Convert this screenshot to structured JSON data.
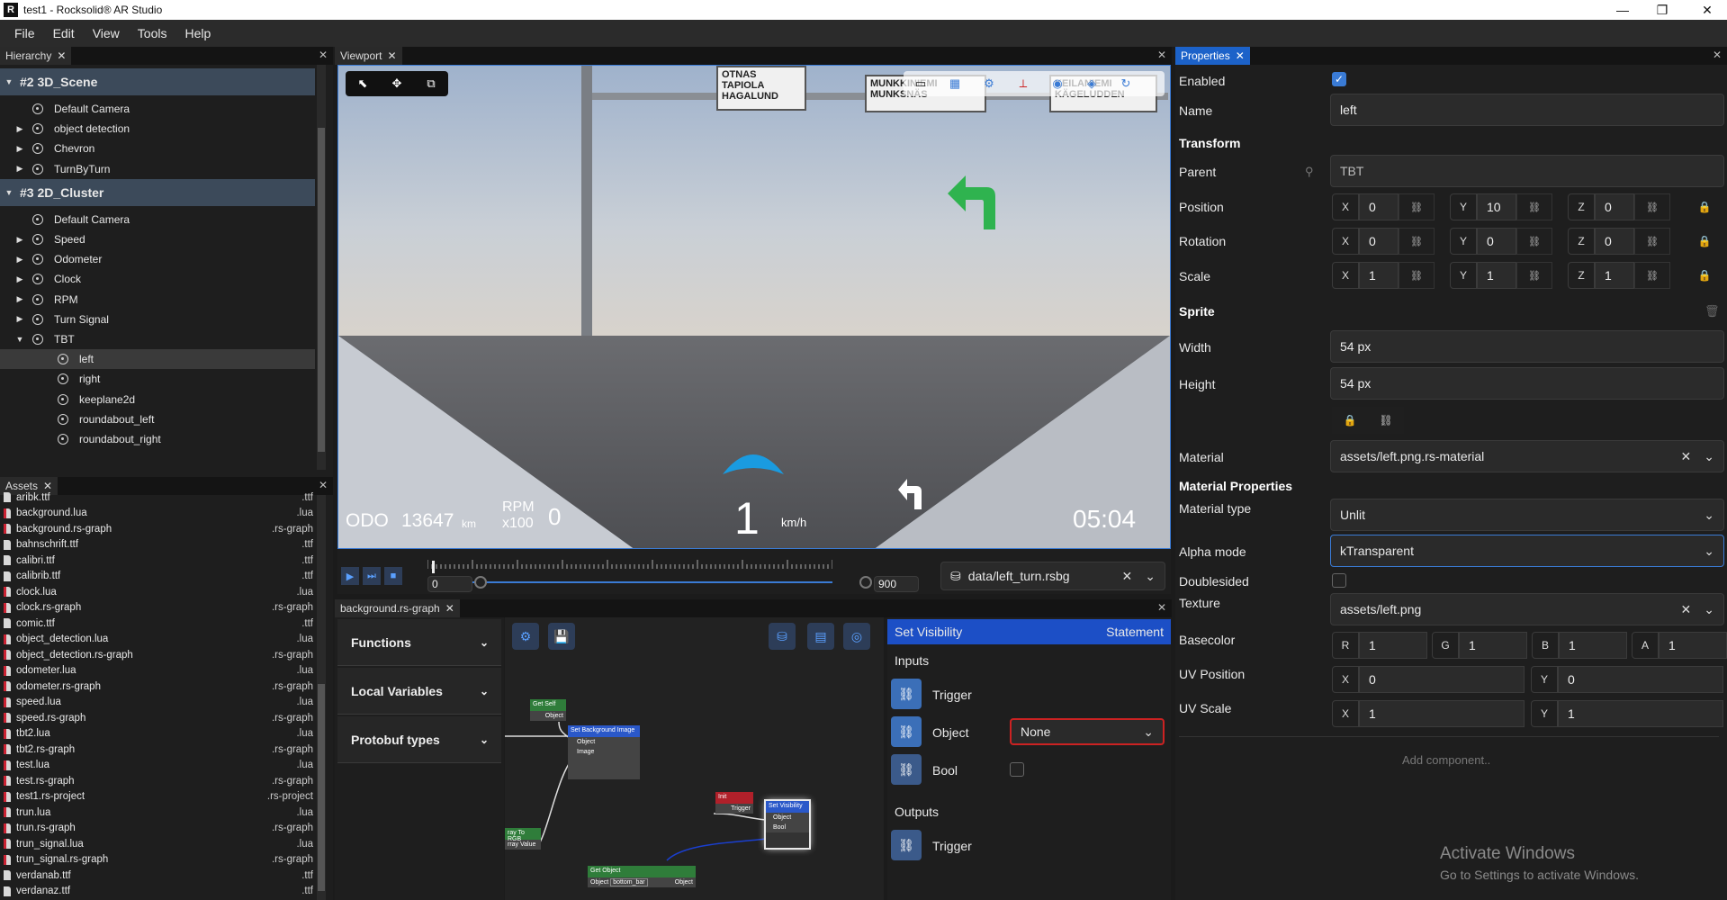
{
  "window": {
    "title": "test1 - Rocksolid® AR Studio",
    "logo": "R"
  },
  "menu": [
    "File",
    "Edit",
    "View",
    "Tools",
    "Help"
  ],
  "hierarchy": {
    "tab": "Hierarchy",
    "rows": [
      {
        "label": "#2 3D_Scene",
        "kind": "group"
      },
      {
        "label": "Default Camera",
        "kind": "item",
        "depth": 1,
        "expandable": false
      },
      {
        "label": "object detection",
        "kind": "item",
        "depth": 1,
        "expandable": true
      },
      {
        "label": "Chevron",
        "kind": "item",
        "depth": 1,
        "expandable": true
      },
      {
        "label": "TurnByTurn",
        "kind": "item",
        "depth": 1,
        "expandable": true
      },
      {
        "label": "#3 2D_Cluster",
        "kind": "group"
      },
      {
        "label": "Default Camera",
        "kind": "item",
        "depth": 1,
        "expandable": false
      },
      {
        "label": "Speed",
        "kind": "item",
        "depth": 1,
        "expandable": true
      },
      {
        "label": "Odometer",
        "kind": "item",
        "depth": 1,
        "expandable": true
      },
      {
        "label": "Clock",
        "kind": "item",
        "depth": 1,
        "expandable": true
      },
      {
        "label": "RPM",
        "kind": "item",
        "depth": 1,
        "expandable": true
      },
      {
        "label": "Turn Signal",
        "kind": "item",
        "depth": 1,
        "expandable": true
      },
      {
        "label": "TBT",
        "kind": "item",
        "depth": 1,
        "expandable": true,
        "expanded": true
      },
      {
        "label": "left",
        "kind": "item",
        "depth": 2,
        "selected": true
      },
      {
        "label": "right",
        "kind": "item",
        "depth": 2
      },
      {
        "label": "keeplane2d",
        "kind": "item",
        "depth": 2
      },
      {
        "label": "roundabout_left",
        "kind": "item",
        "depth": 2
      },
      {
        "label": "roundabout_right",
        "kind": "item",
        "depth": 2
      }
    ]
  },
  "assets": {
    "tab": "Assets",
    "files": [
      {
        "name": "aribk.ttf",
        "ext": ".ttf"
      },
      {
        "name": "background.lua",
        "ext": ".lua"
      },
      {
        "name": "background.rs-graph",
        "ext": ".rs-graph"
      },
      {
        "name": "bahnschrift.ttf",
        "ext": ".ttf"
      },
      {
        "name": "calibri.ttf",
        "ext": ".ttf"
      },
      {
        "name": "calibrib.ttf",
        "ext": ".ttf"
      },
      {
        "name": "clock.lua",
        "ext": ".lua"
      },
      {
        "name": "clock.rs-graph",
        "ext": ".rs-graph"
      },
      {
        "name": "comic.ttf",
        "ext": ".ttf"
      },
      {
        "name": "object_detection.lua",
        "ext": ".lua"
      },
      {
        "name": "object_detection.rs-graph",
        "ext": ".rs-graph"
      },
      {
        "name": "odometer.lua",
        "ext": ".lua"
      },
      {
        "name": "odometer.rs-graph",
        "ext": ".rs-graph"
      },
      {
        "name": "speed.lua",
        "ext": ".lua"
      },
      {
        "name": "speed.rs-graph",
        "ext": ".rs-graph"
      },
      {
        "name": "tbt2.lua",
        "ext": ".lua"
      },
      {
        "name": "tbt2.rs-graph",
        "ext": ".rs-graph"
      },
      {
        "name": "test.lua",
        "ext": ".lua"
      },
      {
        "name": "test.rs-graph",
        "ext": ".rs-graph"
      },
      {
        "name": "test1.rs-project",
        "ext": ".rs-project"
      },
      {
        "name": "trun.lua",
        "ext": ".lua"
      },
      {
        "name": "trun.rs-graph",
        "ext": ".rs-graph"
      },
      {
        "name": "trun_signal.lua",
        "ext": ".lua"
      },
      {
        "name": "trun_signal.rs-graph",
        "ext": ".rs-graph"
      },
      {
        "name": "verdanab.ttf",
        "ext": ".ttf"
      },
      {
        "name": "verdanaz.ttf",
        "ext": ".ttf"
      }
    ]
  },
  "viewport": {
    "tab": "Viewport",
    "signs": [
      "OTNAS",
      "TAPIOLA HAGALUND",
      "MUNKKINIEMI MUNKSNÄS",
      "KEILANIEMI KÄGELUDDEN",
      "MUNKSNÄS"
    ],
    "hud": {
      "odo_label": "ODO",
      "odo_value": "13647",
      "odo_unit": "km",
      "rpm_label": "RPM",
      "rpm_sub": "x100",
      "rpm_value": "0",
      "speed_value": "1",
      "speed_unit": "km/h",
      "clock": "05:04"
    },
    "timeline": {
      "start": "0",
      "end": "900",
      "recording": "data/left_turn.rsbg",
      "playhead": 0.02
    }
  },
  "graph": {
    "tab": "background.rs-graph",
    "sections": [
      "Functions",
      "Local Variables",
      "Protobuf types"
    ],
    "nodes": {
      "get_self": "Get Self",
      "object_out": "Object",
      "set_bg": "Set Background Image",
      "set_bg_object": "Object",
      "set_bg_image": "Image",
      "to_rgb": "ray To RGB",
      "to_rgb_in": "rray",
      "to_rgb_out": "Value",
      "init": "Init",
      "init_trigger": "Trigger",
      "set_vis": "Set Visibility",
      "set_vis_object": "Object",
      "set_vis_bool": "Bool",
      "get_object": "Get Object",
      "get_object_in": "Object",
      "get_object_value": "bottom_bar",
      "get_object_out": "Object"
    },
    "inspector": {
      "title": "Set Visibility",
      "kind": "Statement",
      "inputs_label": "Inputs",
      "outputs_label": "Outputs",
      "inputs": [
        {
          "name": "Trigger"
        },
        {
          "name": "Object",
          "value": "None"
        },
        {
          "name": "Bool"
        }
      ],
      "outputs": [
        {
          "name": "Trigger"
        }
      ]
    }
  },
  "properties": {
    "tab": "Properties",
    "enabled_label": "Enabled",
    "enabled": true,
    "name_label": "Name",
    "name": "left",
    "transform_label": "Transform",
    "parent_label": "Parent",
    "parent": "TBT",
    "position_label": "Position",
    "position": {
      "x": "0",
      "y": "10",
      "z": "0"
    },
    "rotation_label": "Rotation",
    "rotation": {
      "x": "0",
      "y": "0",
      "z": "0"
    },
    "scale_label": "Scale",
    "scale": {
      "x": "1",
      "y": "1",
      "z": "1"
    },
    "sprite_label": "Sprite",
    "width_label": "Width",
    "width": "54 px",
    "height_label": "Height",
    "height": "54 px",
    "material_label": "Material",
    "material": "assets/left.png.rs-material",
    "material_props_label": "Material Properties",
    "material_type_label": "Material type",
    "material_type": "Unlit",
    "alpha_mode_label": "Alpha mode",
    "alpha_mode": "kTransparent",
    "doublesided_label": "Doublesided",
    "doublesided": false,
    "texture_label": "Texture",
    "texture": "assets/left.png",
    "basecolor_label": "Basecolor",
    "basecolor": {
      "r": "1",
      "g": "1",
      "b": "1",
      "a": "1"
    },
    "uv_position_label": "UV Position",
    "uv_position": {
      "x": "0",
      "y": "0"
    },
    "uv_scale_label": "UV Scale",
    "uv_scale": {
      "x": "1",
      "y": "1"
    },
    "add_component": "Add component..",
    "axis_labels": {
      "x": "X",
      "y": "Y",
      "z": "Z",
      "r": "R",
      "g": "G",
      "b": "B",
      "a": "A"
    }
  },
  "watermark": {
    "line1": "Activate Windows",
    "line2": "Go to Settings to activate Windows."
  },
  "colors": {
    "accent": "#1c62c9",
    "turn_arrow": "#2fb34f",
    "chevron": "#1a9be0"
  }
}
